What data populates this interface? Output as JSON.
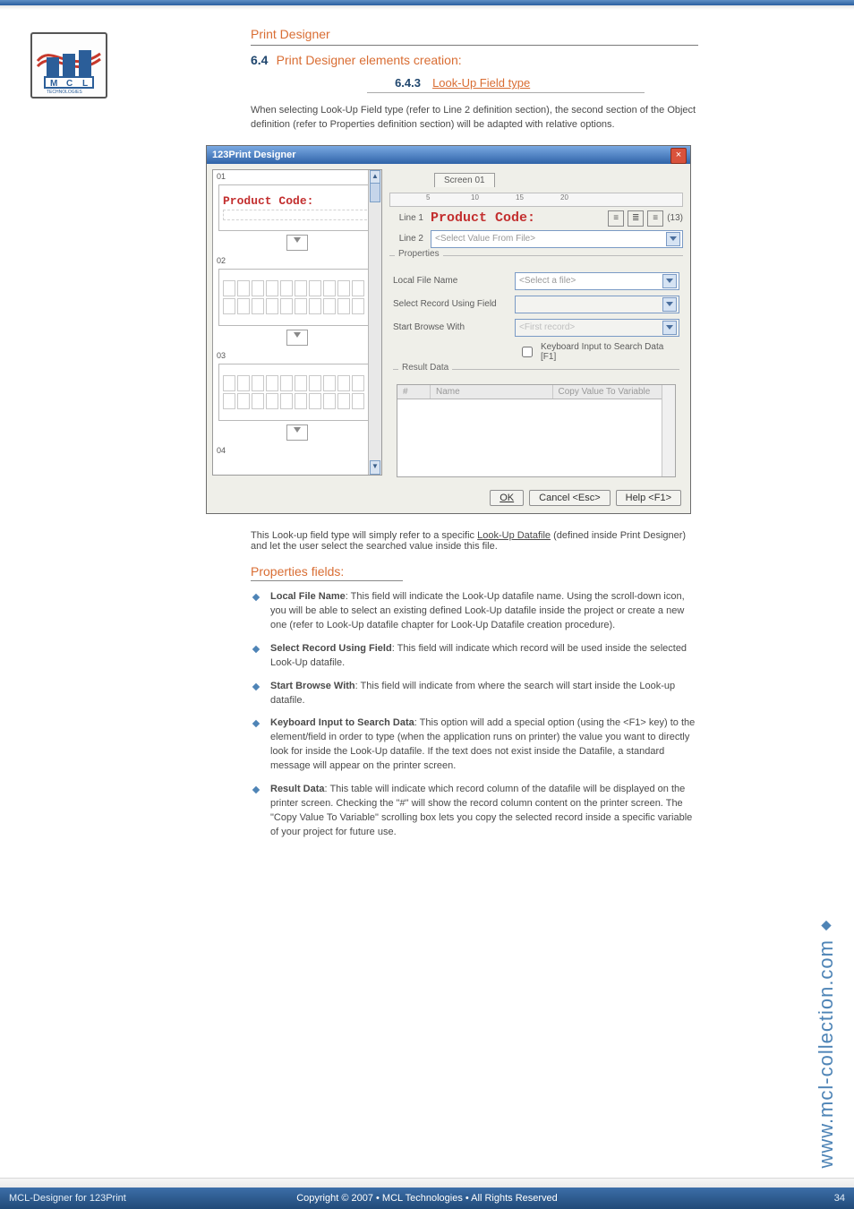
{
  "header": {
    "section": "Print Designer",
    "chapter_num": "6.4",
    "chapter_title": "Print Designer elements creation:",
    "sub_label": "6.4.3",
    "sub_name": "Look-Up Field type",
    "intro": "When selecting Look-Up Field type (refer to Line 2 definition section), the second section of the Object definition (refer to Properties definition section) will be adapted with relative options."
  },
  "figure": {
    "title": "123Print Designer",
    "tab": "Screen 01",
    "line1_label": "Line 1",
    "line1_value": "Product Code:",
    "line1_count": "(13)",
    "line2_label": "Line 2",
    "line2_combo": "<Select Value From File>",
    "properties_label": "Properties",
    "fields": {
      "local_file": "Local File Name",
      "local_file_value": "<Select a file>",
      "select_record": "Select Record Using Field",
      "start_browse": "Start Browse With",
      "start_browse_value": "<First record>",
      "keyboard_chk": "Keyboard Input to Search Data [F1]"
    },
    "result_label": "Result Data",
    "result_head": {
      "c1": "#",
      "c2": "Name",
      "c3": "Copy Value To Variable"
    },
    "btn_ok": "OK",
    "btn_cancel": "Cancel <Esc>",
    "btn_help": "Help <F1>",
    "left_labels": {
      "n01": "01",
      "n02": "02",
      "n03": "03",
      "n04": "04",
      "code": "Product Code:"
    }
  },
  "below": {
    "lead_prefix": "This Look-up field type will simply refer to a specific ",
    "lead_link": "Look-Up Datafile",
    "lead_suffix": " (defined inside Print Designer) and let the user select the searched value inside this file.",
    "props_title": "Properties fields:",
    "items": [
      {
        "key": "Local File Name",
        "text": ": This field will indicate the Look-Up datafile name. Using the scroll-down icon, you will be able to select an existing defined Look-Up datafile inside the project or create a new one (refer to Look-Up datafile chapter for Look-Up Datafile creation procedure)."
      },
      {
        "key": "Select Record Using Field",
        "text": ": This field will indicate which record will be used inside the selected Look-Up datafile."
      },
      {
        "key": "Start Browse With",
        "text": ": This field will indicate from where the search will start inside the Look-up datafile."
      },
      {
        "key": "Keyboard Input to Search Data",
        "text": ": This option will add a special option (using the <F1> key) to the element/field in order to type (when the application runs on printer) the value you want to directly look for inside the Look-Up datafile. If the text does not exist inside the Datafile, a standard message will appear on the printer screen."
      },
      {
        "key": "Result Data",
        "text": ": This table will indicate which record column of the datafile will be displayed on the printer screen. Checking the \"#\" will show the record column content on the printer screen. The \"Copy Value To Variable\" scrolling box lets you copy the selected record inside a specific variable of your project for future use."
      }
    ]
  },
  "side_url": "www.mcl-collection.com",
  "footer": {
    "left": "MCL-Designer for 123Print",
    "center": "Copyright © 2007 • MCL Technologies • All Rights Reserved",
    "right": "34"
  }
}
